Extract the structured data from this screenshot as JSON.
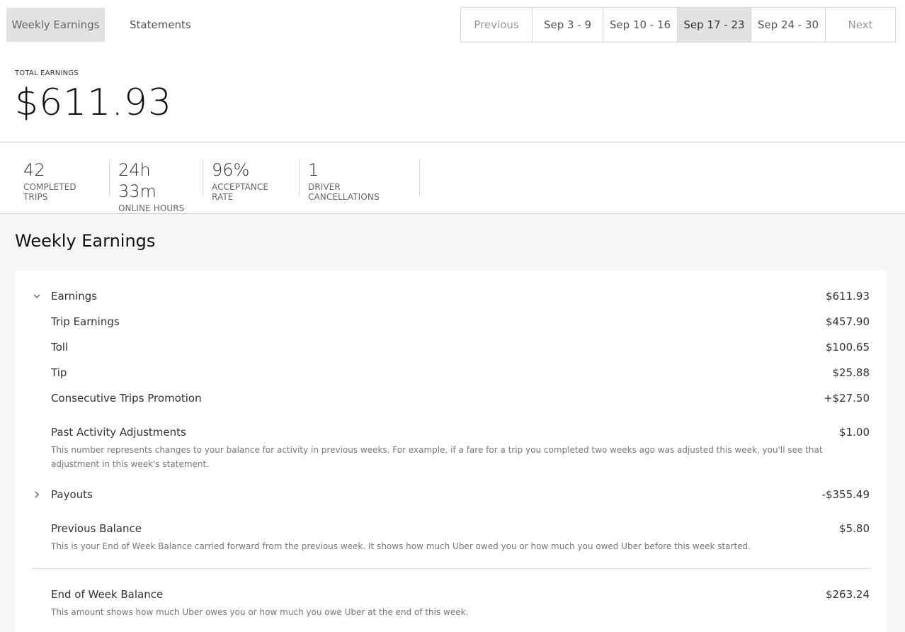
{
  "tabs": {
    "weekly": "Weekly Earnings",
    "statements": "Statements"
  },
  "weeks": {
    "previous": "Previous",
    "items": [
      "Sep 3 - 9",
      "Sep 10 - 16",
      "Sep 17 - 23",
      "Sep 24 - 30"
    ],
    "next": "Next",
    "selected_index": 2
  },
  "total": {
    "label": "TOTAL EARNINGS",
    "value": "$611.93"
  },
  "stats": [
    {
      "value": "42",
      "label": "COMPLETED TRIPS"
    },
    {
      "value": "24h 33m",
      "label": "ONLINE HOURS"
    },
    {
      "value": "96%",
      "label": "ACCEPTANCE RATE"
    },
    {
      "value": "1",
      "label": "DRIVER CANCELLATIONS"
    }
  ],
  "section": {
    "title": "Weekly Earnings"
  },
  "rows": {
    "earnings": {
      "label": "Earnings",
      "amount": "$611.93",
      "icon": "chevron-down-icon"
    },
    "trip_earnings": {
      "label": "Trip Earnings",
      "amount": "$457.90"
    },
    "toll": {
      "label": "Toll",
      "amount": "$100.65"
    },
    "tip": {
      "label": "Tip",
      "amount": "$25.88"
    },
    "promotion": {
      "label": "Consecutive Trips Promotion",
      "amount": "+$27.50"
    },
    "adjustments": {
      "label": "Past Activity Adjustments",
      "amount": "$1.00",
      "desc": "This number represents changes to your balance for activity in previous weeks. For example, if a fare for a trip you completed two weeks ago was adjusted this week, you'll see that adjustment in this week's statement."
    },
    "payouts": {
      "label": "Payouts",
      "amount": "-$355.49",
      "icon": "chevron-right-icon"
    },
    "previous_balance": {
      "label": "Previous Balance",
      "amount": "$5.80",
      "desc": "This is your End of Week Balance carried forward from the previous week. It shows how much Uber owed you or how much you owed Uber before this week started."
    },
    "end_balance": {
      "label": "End of Week Balance",
      "amount": "$263.24",
      "desc": "This amount shows how much Uber owes you or how much you owe Uber at the end of this week."
    }
  }
}
